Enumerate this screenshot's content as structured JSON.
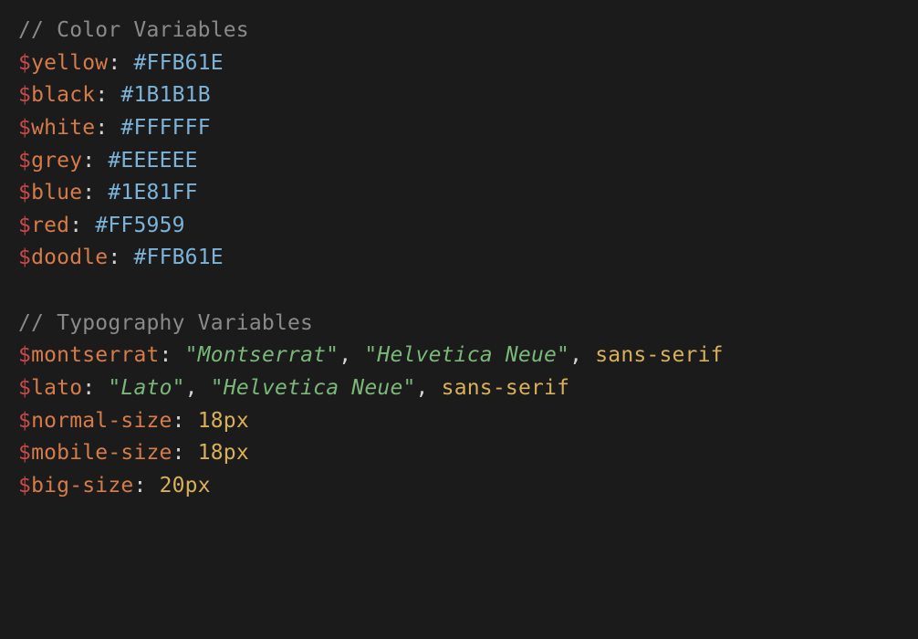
{
  "lines": [
    {
      "type": "comment",
      "text": "// Color Variables"
    },
    {
      "type": "hexvar",
      "name": "yellow",
      "value": "#FFB61E"
    },
    {
      "type": "hexvar",
      "name": "black",
      "value": "#1B1B1B"
    },
    {
      "type": "hexvar",
      "name": "white",
      "value": "#FFFFFF"
    },
    {
      "type": "hexvar",
      "name": "grey",
      "value": "#EEEEEE"
    },
    {
      "type": "hexvar",
      "name": "blue",
      "value": "#1E81FF"
    },
    {
      "type": "hexvar",
      "name": "red",
      "value": "#FF5959"
    },
    {
      "type": "hexvar",
      "name": "doodle",
      "value": "#FFB61E"
    },
    {
      "type": "blank"
    },
    {
      "type": "comment",
      "text": "// Typography Variables"
    },
    {
      "type": "fontvar",
      "name": "montserrat",
      "strings": [
        "\"Montserrat\"",
        "\"Helvetica Neue\""
      ],
      "tail": "sans-serif"
    },
    {
      "type": "fontvar",
      "name": "lato",
      "strings": [
        "\"Lato\"",
        "\"Helvetica Neue\""
      ],
      "tail": "sans-serif"
    },
    {
      "type": "pxvar",
      "name": "normal-size",
      "value": "18px"
    },
    {
      "type": "pxvar",
      "name": "mobile-size",
      "value": "18px"
    },
    {
      "type": "pxvar",
      "name": "big-size",
      "value": "20px"
    }
  ]
}
